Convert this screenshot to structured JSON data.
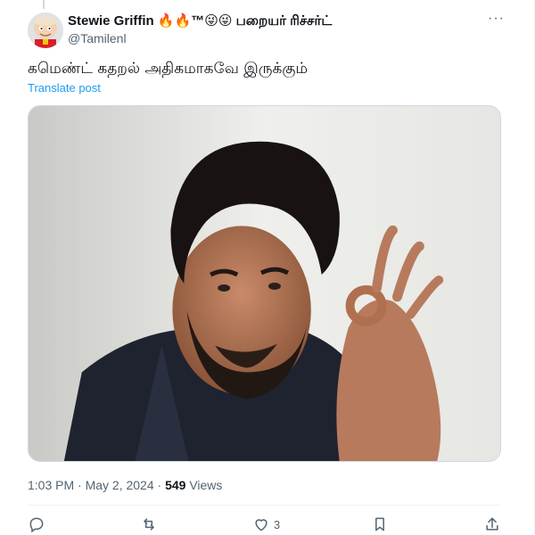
{
  "author": {
    "display_name": "Stewie Griffin 🔥🔥™😜😜 பறையர் ரிச்சர்ட்",
    "handle": "@Tamilenl"
  },
  "post": {
    "text": "கமெண்ட் கதறல் அதிகமாகவே இருக்கும்",
    "translate_label": "Translate post"
  },
  "meta": {
    "timestamp": "1:03 PM · May 2, 2024 · ",
    "views_count": "549",
    "views_label": " Views"
  },
  "actions": {
    "reply_count": "",
    "repost_count": "",
    "like_count": "3",
    "bookmark_count": ""
  },
  "icons": {
    "more": "more-icon",
    "reply": "reply-icon",
    "repost": "repost-icon",
    "like": "heart-icon",
    "bookmark": "bookmark-icon",
    "share": "share-icon"
  },
  "colors": {
    "text_primary": "#0f1419",
    "text_secondary": "#536471",
    "link": "#1d9bf0",
    "border": "#cfd9de"
  }
}
